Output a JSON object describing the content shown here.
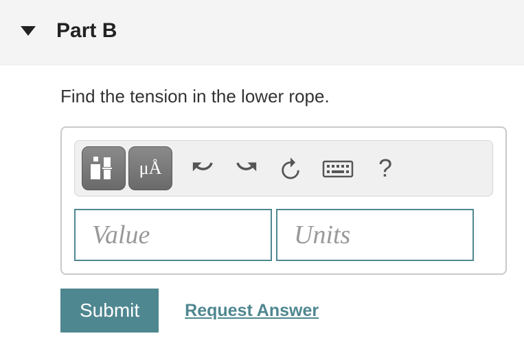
{
  "header": {
    "title": "Part B"
  },
  "question": {
    "text": "Find the tension in the lower rope."
  },
  "toolbar": {
    "template_label": "template",
    "symbols_label": "μÅ"
  },
  "inputs": {
    "value_placeholder": "Value",
    "value": "",
    "units_placeholder": "Units",
    "units": ""
  },
  "actions": {
    "submit_label": "Submit",
    "request_answer_label": "Request Answer"
  }
}
